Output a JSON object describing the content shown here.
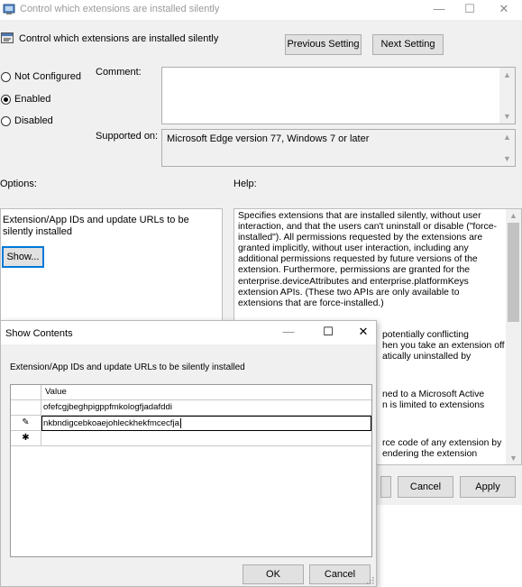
{
  "window": {
    "title": "Control which extensions are installed silently",
    "minimize": "—",
    "maximize": "☐",
    "close": "✕"
  },
  "header": {
    "title": "Control which extensions are installed silently",
    "prev_label": "Previous Setting",
    "next_label": "Next Setting"
  },
  "state": {
    "options": [
      {
        "label": "Not Configured",
        "checked": false
      },
      {
        "label": "Enabled",
        "checked": true
      },
      {
        "label": "Disabled",
        "checked": false
      }
    ],
    "comment_label": "Comment:",
    "comment_value": "",
    "supported_label": "Supported on:",
    "supported_value": "Microsoft Edge version 77, Windows 7 or later"
  },
  "options_pane": {
    "heading": "Options:",
    "description": "Extension/App IDs and update URLs to be silently installed",
    "show_label": "Show..."
  },
  "help_pane": {
    "heading": "Help:",
    "text": "Specifies extensions that are installed silently, without user interaction, and that the users can't uninstall or disable (\"force-installed\"). All permissions requested by the extensions are granted implicitly, without user interaction, including any additional permissions requested by future versions of the extension. Furthermore, permissions are granted for the enterprise.deviceAttributes and enterprise.platformKeys extension APIs. (These two APIs are only available to extensions that are force-installed.)",
    "fragments": [
      "potentially conflicting",
      "hen you take an extension off",
      "atically uninstalled by",
      "ned to a Microsoft Active",
      "n is limited to extensions",
      "rce code of any extension by",
      "endering the extension"
    ]
  },
  "footer": {
    "cancel_label": "Cancel",
    "apply_label": "Apply"
  },
  "dialog": {
    "title": "Show Contents",
    "label": "Extension/App IDs and update URLs to be silently installed",
    "column_header": "Value",
    "rows": [
      {
        "marker": "",
        "value": "ofefcgjbeghpigppfmkologfjadafddi"
      },
      {
        "marker": "✎",
        "value": "nkbndigcebkoaejohleckhekfmcecfja"
      },
      {
        "marker": "✱",
        "value": ""
      }
    ],
    "ok_label": "OK",
    "cancel_label": "Cancel"
  },
  "colors": {
    "accent": "#0078d7",
    "window_bg": "#f0f0f0"
  }
}
